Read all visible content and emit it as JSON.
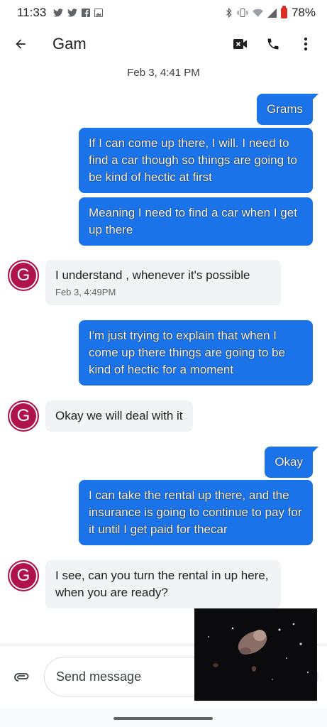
{
  "status_bar": {
    "time": "11:33",
    "battery": "78%"
  },
  "header": {
    "contact_name": "Gam"
  },
  "conversation": {
    "date_header": "Feb 3, 4:41 PM",
    "avatar_letter": "G",
    "messages": [
      {
        "direction": "out",
        "text": "Grams"
      },
      {
        "direction": "out",
        "text": "If I can come up there, I will. I need to find a car though so things are going to be kind of hectic at first"
      },
      {
        "direction": "out",
        "text": "Meaning I need to find a car when I get up there"
      },
      {
        "direction": "in",
        "text": "I understand , whenever it's possible",
        "time": "Feb 3, 4:49PM"
      },
      {
        "direction": "out",
        "text": "I'm just trying to explain that when I come up there things are going to be kind of hectic for a moment"
      },
      {
        "direction": "in",
        "text": "Okay we will deal with it"
      },
      {
        "direction": "out",
        "text": "Okay"
      },
      {
        "direction": "out",
        "text": "I can take the rental up there, and the insurance is going to continue to pay for it until I get paid for thecar"
      },
      {
        "direction": "in",
        "text": "I see, can you turn the rental in up here, when you are ready?"
      }
    ]
  },
  "composer": {
    "placeholder": "Send message"
  }
}
